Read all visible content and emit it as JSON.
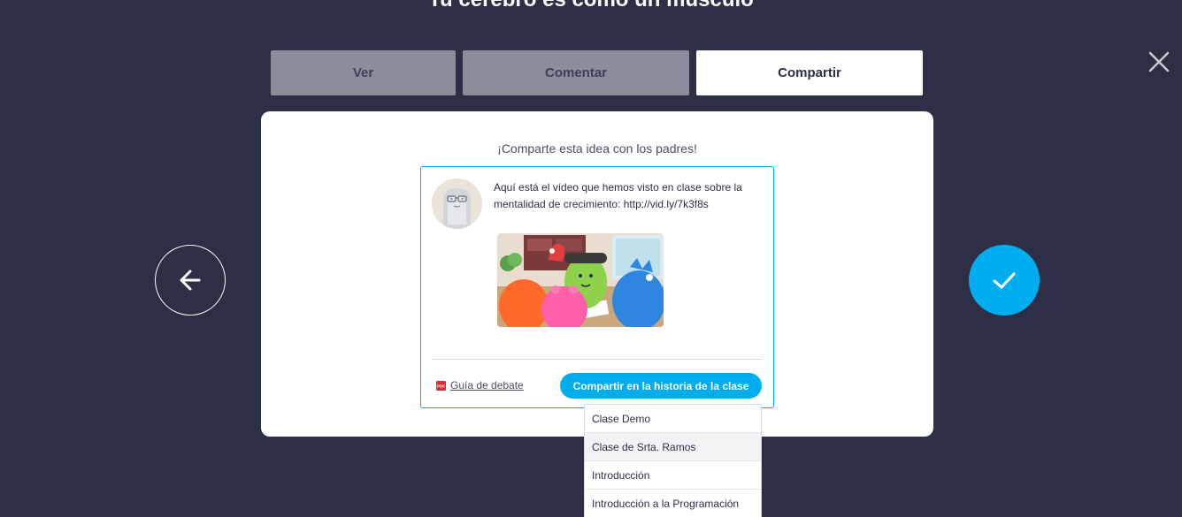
{
  "page": {
    "title": "Tu cerebro es como un músculo"
  },
  "tabs": [
    {
      "label": "Ver",
      "active": false
    },
    {
      "label": "Comentar",
      "active": false
    },
    {
      "label": "Compartir",
      "active": true
    }
  ],
  "card": {
    "heading": "¡Comparte esta idea con los padres!",
    "post_text": "Aquí está el vídeo que hemos visto en clase sobre la mentalidad de crecimiento: http://vid.ly/7k3f8s",
    "guide_link": "Guía de debate",
    "share_button": "Compartir en la historia de la clase"
  },
  "dropdown": {
    "options": [
      "Clase Demo",
      "Clase de Srta. Ramos",
      "Introducción",
      "Introducción a la Programación"
    ]
  },
  "icons": {
    "close": "close-icon",
    "back": "arrow-left-icon",
    "confirm": "checkmark-icon",
    "pdf": "pdf-icon"
  },
  "colors": {
    "background": "#2c2f45",
    "accent": "#00aef0",
    "tab_inactive": "#8b8d9d",
    "card": "#ffffff"
  }
}
